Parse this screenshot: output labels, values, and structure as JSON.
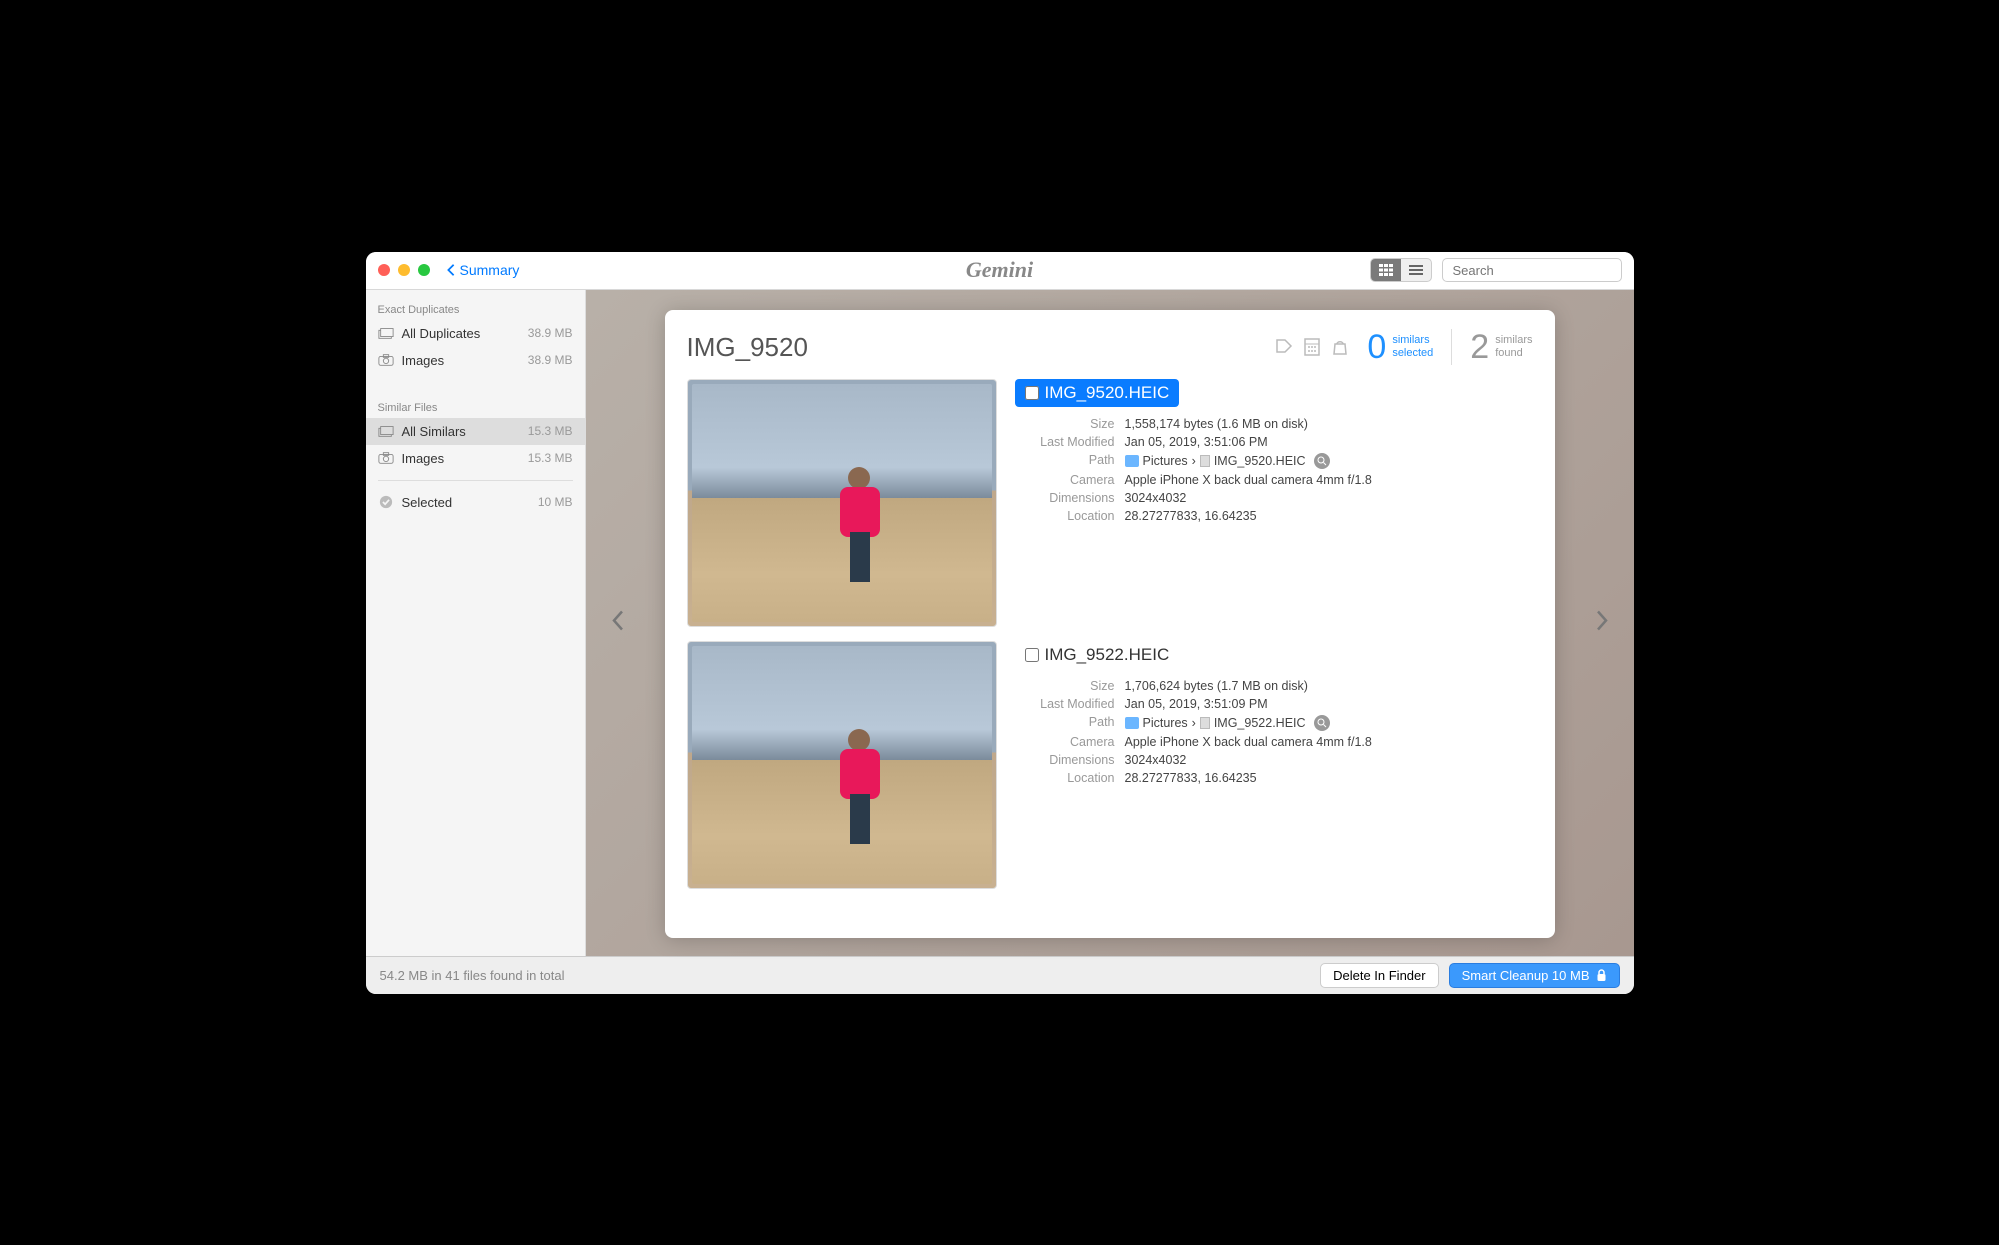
{
  "titlebar": {
    "back_label": "Summary",
    "logo": "Gemini",
    "search_placeholder": "Search"
  },
  "sidebar": {
    "section1_title": "Exact Duplicates",
    "section1": [
      {
        "label": "All Duplicates",
        "size": "38.9 MB"
      },
      {
        "label": "Images",
        "size": "38.9 MB"
      }
    ],
    "section2_title": "Similar Files",
    "section2": [
      {
        "label": "All Similars",
        "size": "15.3 MB"
      },
      {
        "label": "Images",
        "size": "15.3 MB"
      }
    ],
    "selected_label": "Selected",
    "selected_size": "10 MB"
  },
  "card": {
    "title": "IMG_9520",
    "stat_selected_num": "0",
    "stat_selected_l1": "similars",
    "stat_selected_l2": "selected",
    "stat_found_num": "2",
    "stat_found_l1": "similars",
    "stat_found_l2": "found"
  },
  "labels": {
    "size": "Size",
    "modified": "Last Modified",
    "path": "Path",
    "camera": "Camera",
    "dimensions": "Dimensions",
    "location": "Location",
    "chevron": "›"
  },
  "items": [
    {
      "filename": "IMG_9520.HEIC",
      "selected": true,
      "size": "1,558,174 bytes (1.6 MB on disk)",
      "modified": "Jan 05, 2019, 3:51:06 PM",
      "path_folder": "Pictures",
      "path_file": "IMG_9520.HEIC",
      "camera": "Apple iPhone X back dual camera 4mm f/1.8",
      "dimensions": "3024x4032",
      "location": "28.27277833, 16.64235"
    },
    {
      "filename": "IMG_9522.HEIC",
      "selected": false,
      "size": "1,706,624 bytes (1.7 MB on disk)",
      "modified": "Jan 05, 2019, 3:51:09 PM",
      "path_folder": "Pictures",
      "path_file": "IMG_9522.HEIC",
      "camera": "Apple iPhone X back dual camera 4mm f/1.8",
      "dimensions": "3024x4032",
      "location": "28.27277833, 16.64235"
    }
  ],
  "footer": {
    "status": "54.2 MB in 41 files found in total",
    "delete": "Delete In Finder",
    "cleanup": "Smart Cleanup 10 MB"
  }
}
